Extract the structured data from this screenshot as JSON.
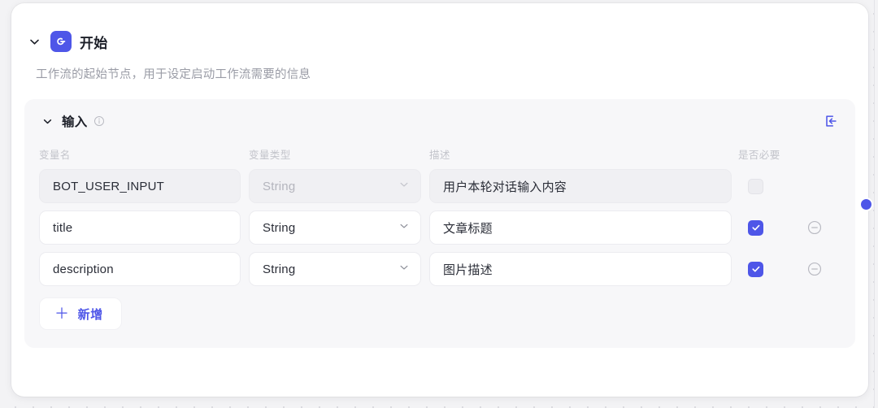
{
  "node": {
    "title": "开始",
    "description": "工作流的起始节点，用于设定启动工作流需要的信息",
    "icon": "start-power-icon",
    "collapse_icon": "chevron-down-icon",
    "accent_color": "#4E56E8"
  },
  "panel": {
    "title": "输入",
    "info_icon": "info-circle-icon",
    "import_icon": "import-arrow-icon",
    "collapse_icon": "chevron-down-icon",
    "columns": {
      "name": "变量名",
      "type": "变量类型",
      "description": "描述",
      "required": "是否必要"
    },
    "rows": [
      {
        "name": "BOT_USER_INPUT",
        "type": "String",
        "type_is_placeholder": true,
        "description": "用户本轮对话输入内容",
        "required": false,
        "editable": false,
        "removable": false,
        "dropdown_icon": "chevron-down-icon"
      },
      {
        "name": "title",
        "type": "String",
        "type_is_placeholder": false,
        "description": "文章标题",
        "required": true,
        "editable": true,
        "removable": true,
        "dropdown_icon": "chevron-down-icon",
        "remove_icon": "minus-circle-icon"
      },
      {
        "name": "description",
        "type": "String",
        "type_is_placeholder": false,
        "description": "图片描述",
        "required": true,
        "editable": true,
        "removable": true,
        "dropdown_icon": "chevron-down-icon",
        "remove_icon": "minus-circle-icon"
      }
    ],
    "add_button": {
      "label": "新增",
      "icon": "plus-icon"
    }
  },
  "port": {
    "name": "output-connection-port"
  }
}
